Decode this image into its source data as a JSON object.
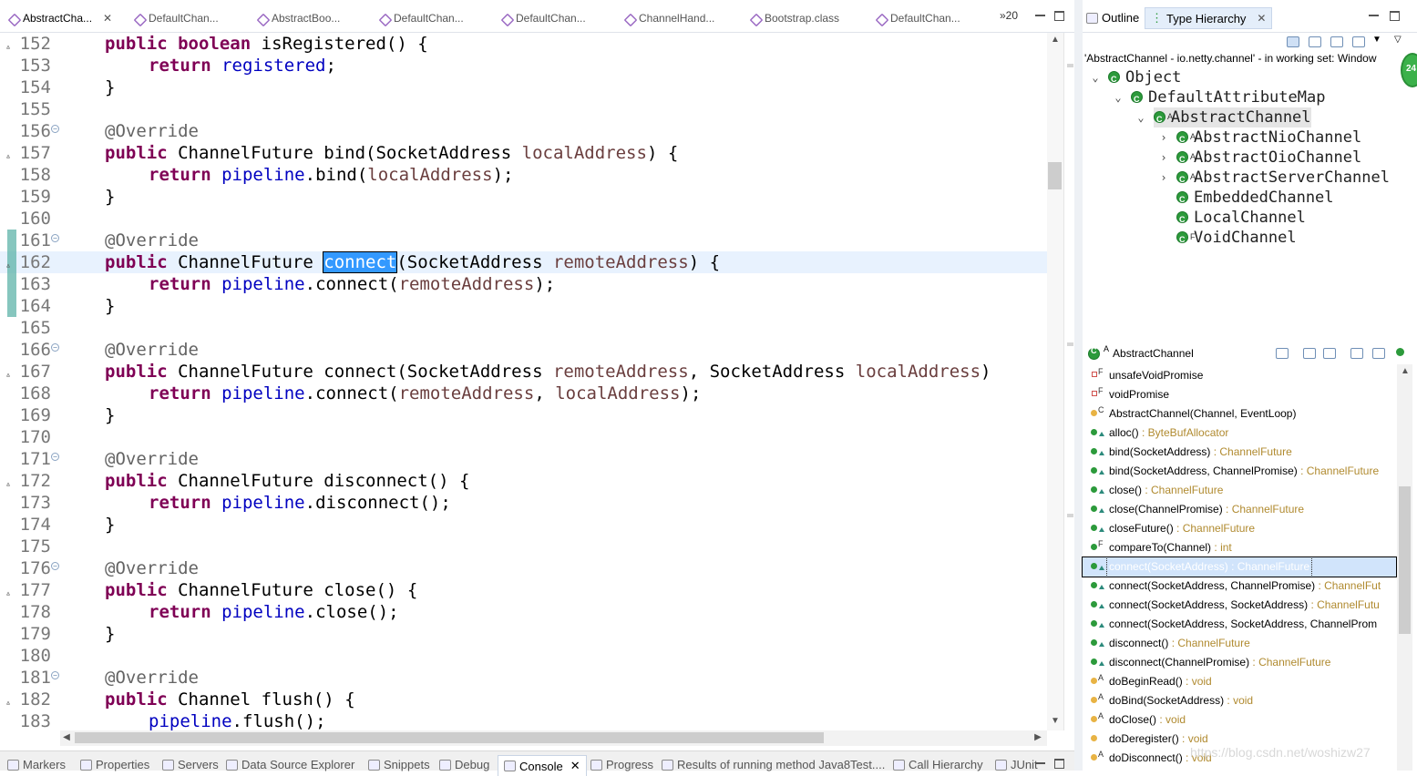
{
  "editor_tabs": [
    {
      "label": "AbstractCha...",
      "active": true
    },
    {
      "label": "DefaultChan..."
    },
    {
      "label": "AbstractBoo..."
    },
    {
      "label": "DefaultChan..."
    },
    {
      "label": "DefaultChan..."
    },
    {
      "label": "ChannelHand..."
    },
    {
      "label": "Bootstrap.class"
    },
    {
      "label": "DefaultChan..."
    }
  ],
  "overflow_count": "»20",
  "close_glyph": "✕",
  "code": {
    "selected_word": "connect",
    "lines": [
      {
        "n": "152",
        "t": "public boolean isRegistered() {"
      },
      {
        "n": "153",
        "t": "return registered;"
      },
      {
        "n": "154",
        "t": "}"
      },
      {
        "n": "155",
        "t": ""
      },
      {
        "n": "156",
        "t": "@Override"
      },
      {
        "n": "157",
        "t": "public ChannelFuture bind(SocketAddress localAddress) {"
      },
      {
        "n": "158",
        "t": "return pipeline.bind(localAddress);"
      },
      {
        "n": "159",
        "t": "}"
      },
      {
        "n": "160",
        "t": ""
      },
      {
        "n": "161",
        "t": "@Override"
      },
      {
        "n": "162",
        "t": "public ChannelFuture connect(SocketAddress remoteAddress) {"
      },
      {
        "n": "163",
        "t": "return pipeline.connect(remoteAddress);"
      },
      {
        "n": "164",
        "t": "}"
      },
      {
        "n": "165",
        "t": ""
      },
      {
        "n": "166",
        "t": "@Override"
      },
      {
        "n": "167",
        "t": "public ChannelFuture connect(SocketAddress remoteAddress, SocketAddress localAddress)"
      },
      {
        "n": "168",
        "t": "return pipeline.connect(remoteAddress, localAddress);"
      },
      {
        "n": "169",
        "t": "}"
      },
      {
        "n": "170",
        "t": ""
      },
      {
        "n": "171",
        "t": "@Override"
      },
      {
        "n": "172",
        "t": "public ChannelFuture disconnect() {"
      },
      {
        "n": "173",
        "t": "return pipeline.disconnect();"
      },
      {
        "n": "174",
        "t": "}"
      },
      {
        "n": "175",
        "t": ""
      },
      {
        "n": "176",
        "t": "@Override"
      },
      {
        "n": "177",
        "t": "public ChannelFuture close() {"
      },
      {
        "n": "178",
        "t": "return pipeline.close();"
      },
      {
        "n": "179",
        "t": "}"
      },
      {
        "n": "180",
        "t": ""
      },
      {
        "n": "181",
        "t": "@Override"
      },
      {
        "n": "182",
        "t": "public Channel flush() {"
      },
      {
        "n": "183",
        "t": "pipeline.flush();"
      }
    ]
  },
  "bottom_tabs": [
    {
      "label": "Markers"
    },
    {
      "label": "Properties"
    },
    {
      "label": "Servers"
    },
    {
      "label": "Data Source Explorer"
    },
    {
      "label": "Snippets"
    },
    {
      "label": "Debug"
    },
    {
      "label": "Console",
      "active": true
    },
    {
      "label": "Progress"
    },
    {
      "label": "Results of running method Java8Test...."
    },
    {
      "label": "Call Hierarchy"
    },
    {
      "label": "JUnit"
    }
  ],
  "right_panel": {
    "tabs": [
      {
        "label": "Outline"
      },
      {
        "label": "Type Hierarchy",
        "active": true
      }
    ],
    "scope": "'AbstractChannel - io.netty.channel' - in working set: Window",
    "badge": "24",
    "hierarchy": [
      {
        "name": "Object",
        "mod": ""
      },
      {
        "name": "DefaultAttributeMap",
        "mod": ""
      },
      {
        "name": "AbstractChannel",
        "mod": "A"
      },
      {
        "name": "AbstractNioChannel",
        "mod": "A"
      },
      {
        "name": "AbstractOioChannel",
        "mod": "A"
      },
      {
        "name": "AbstractServerChannel",
        "mod": "A"
      },
      {
        "name": "EmbeddedChannel",
        "mod": ""
      },
      {
        "name": "LocalChannel",
        "mod": ""
      },
      {
        "name": "VoidChannel",
        "mod": "F"
      }
    ],
    "members_title": "AbstractChannel",
    "members": [
      {
        "vis": "priv",
        "mod": "F",
        "label": "unsafeVoidPromise",
        "type": ""
      },
      {
        "vis": "priv",
        "mod": "F",
        "label": "voidPromise",
        "type": ""
      },
      {
        "vis": "ctor",
        "mod": "C",
        "label": "AbstractChannel(Channel, EventLoop)",
        "type": ""
      },
      {
        "vis": "pub",
        "mod": "▲",
        "label": "alloc()",
        "type": " : ByteBufAllocator"
      },
      {
        "vis": "pub",
        "mod": "▲",
        "label": "bind(SocketAddress)",
        "type": " : ChannelFuture"
      },
      {
        "vis": "pub",
        "mod": "▲",
        "label": "bind(SocketAddress, ChannelPromise)",
        "type": " : ChannelFuture"
      },
      {
        "vis": "pub",
        "mod": "▲",
        "label": "close()",
        "type": " : ChannelFuture"
      },
      {
        "vis": "pub",
        "mod": "▲",
        "label": "close(ChannelPromise)",
        "type": " : ChannelFuture"
      },
      {
        "vis": "pub",
        "mod": "▲",
        "label": "closeFuture()",
        "type": " : ChannelFuture"
      },
      {
        "vis": "pub",
        "mod": "F",
        "label": "compareTo(Channel)",
        "type": " : int"
      },
      {
        "vis": "pub",
        "mod": "▲",
        "label": "connect(SocketAddress) : ChannelFuture",
        "type": "",
        "selected": true
      },
      {
        "vis": "pub",
        "mod": "▲",
        "label": "connect(SocketAddress, ChannelPromise)",
        "type": " : ChannelFut"
      },
      {
        "vis": "pub",
        "mod": "▲",
        "label": "connect(SocketAddress, SocketAddress)",
        "type": " : ChannelFutu"
      },
      {
        "vis": "pub",
        "mod": "▲",
        "label": "connect(SocketAddress, SocketAddress, ChannelProm",
        "type": ""
      },
      {
        "vis": "pub",
        "mod": "▲",
        "label": "disconnect()",
        "type": " : ChannelFuture"
      },
      {
        "vis": "pub",
        "mod": "▲",
        "label": "disconnect(ChannelPromise)",
        "type": " : ChannelFuture"
      },
      {
        "vis": "prot",
        "mod": "A",
        "label": "doBeginRead()",
        "type": " : void"
      },
      {
        "vis": "prot",
        "mod": "A",
        "label": "doBind(SocketAddress)",
        "type": " : void"
      },
      {
        "vis": "prot",
        "mod": "A",
        "label": "doClose()",
        "type": " : void"
      },
      {
        "vis": "prot",
        "mod": "",
        "label": "doDeregister()",
        "type": " : void"
      },
      {
        "vis": "prot",
        "mod": "A",
        "label": "doDisconnect()",
        "type": " : void"
      }
    ]
  },
  "watermark": "https://blog.csdn.net/woshizw27",
  "colors": {
    "keyword": "#7f0055",
    "field": "#0000c0",
    "param": "#6a3e3e",
    "selection": "#3399ff",
    "current_line": "#e8f2fe"
  }
}
